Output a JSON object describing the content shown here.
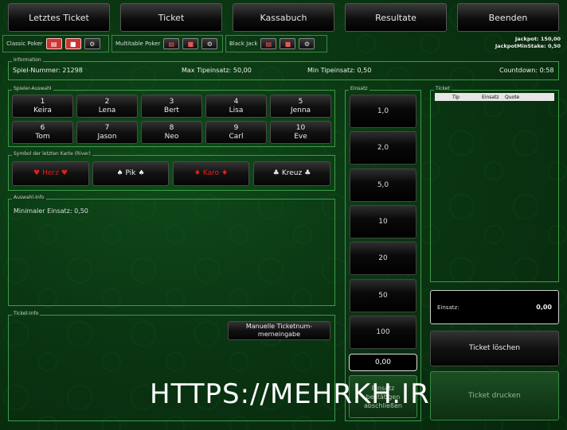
{
  "nav": {
    "letztes_ticket": "Letztes Ticket",
    "ticket": "Ticket",
    "kassabuch": "Kassabuch",
    "resultate": "Resultate",
    "beenden": "Beenden"
  },
  "games": {
    "classic_poker": "Classic Poker",
    "multitable_poker": "Multitable Poker",
    "black_jack": "Black Jack"
  },
  "jackpot": {
    "jackpot": "Jackpot: 150,00",
    "min_stake": "JackpotMinStake: 0,50"
  },
  "information": {
    "title": "Information",
    "spiel_nummer": "Spiel-Nummer:  21298",
    "max_tipeinsatz": "Max Tipeinsatz:  50,00",
    "min_tipeinsatz": "Min Tipeinsatz:  0,50",
    "countdown": "Countdown:  0:58"
  },
  "spieler_auswahl": {
    "title": "Spieler-Auswahl",
    "players": [
      {
        "num": "1",
        "name": "Keira"
      },
      {
        "num": "2",
        "name": "Lena"
      },
      {
        "num": "3",
        "name": "Bert"
      },
      {
        "num": "4",
        "name": "Lisa"
      },
      {
        "num": "5",
        "name": "Jenna"
      },
      {
        "num": "6",
        "name": "Tom"
      },
      {
        "num": "7",
        "name": "Jason"
      },
      {
        "num": "8",
        "name": "Neo"
      },
      {
        "num": "9",
        "name": "Carl"
      },
      {
        "num": "10",
        "name": "Eve"
      }
    ]
  },
  "symbol": {
    "title": "Symbol der letzten Karte (River)",
    "herz": "Herz",
    "pik": "Pik",
    "karo": "Karo",
    "kreuz": "Kreuz",
    "heart_color": "#e0201c",
    "diamond_color": "#e0201c"
  },
  "auswahl_info": {
    "title": "Auswahl-Info",
    "text": "Minimaler Einsatz: 0,50"
  },
  "ticket_info": {
    "title": "Ticket-Info",
    "manual_line1": "Manuelle Ticketnum-",
    "manual_line2": "merneingabe"
  },
  "einsatz": {
    "title": "Einsatz",
    "values": [
      "1,0",
      "2,0",
      "5,0",
      "10",
      "20",
      "50",
      "100"
    ],
    "current": "0,00",
    "confirm_line1": "Einsatz",
    "confirm_line2": "bestätigen",
    "confirm_line3": "abschließen"
  },
  "ticket": {
    "title": "Ticket",
    "col_tip": "Tip",
    "col_einsatz": "Einsatz",
    "col_quote": "Quote",
    "einsatz_label": "Einsatz:",
    "einsatz_value": "0,00",
    "loeschen": "Ticket löschen",
    "drucken": "Ticket drucken"
  },
  "watermark": "HTTPS://MEHRKH.IR"
}
